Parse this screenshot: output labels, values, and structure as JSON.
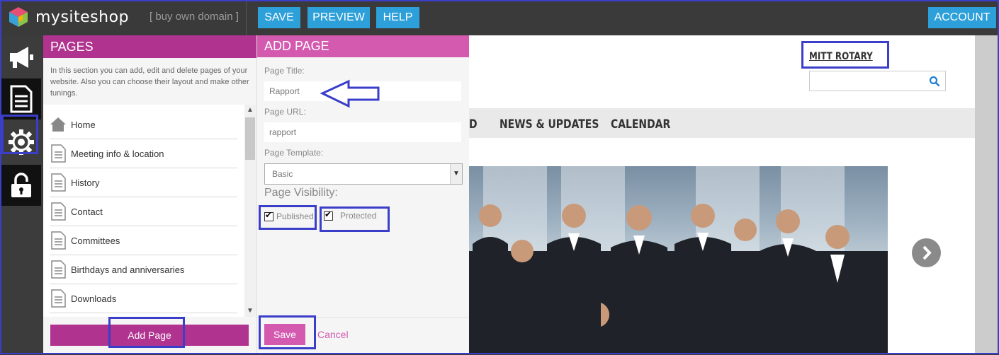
{
  "topbar": {
    "logo_text": "mysiteshop",
    "domain_link": "[ buy own domain ]",
    "buttons": {
      "save": "SAVE",
      "preview": "PREVIEW",
      "help": "HELP",
      "account": "ACCOUNT"
    },
    "accent_color": "#2d9fd9"
  },
  "rail": {
    "items": [
      {
        "icon": "megaphone-icon"
      },
      {
        "icon": "document-icon",
        "selected": true
      },
      {
        "icon": "gear-icon"
      },
      {
        "icon": "lock-icon"
      }
    ]
  },
  "pages_panel": {
    "title": "PAGES",
    "description": "In this section you can add, edit and delete pages of your website. Also you can choose their layout and make other tunings.",
    "items": [
      {
        "label": "Home",
        "icon": "home-icon"
      },
      {
        "label": "Meeting info & location",
        "icon": "page-icon"
      },
      {
        "label": "History",
        "icon": "page-icon"
      },
      {
        "label": "Contact",
        "icon": "page-icon"
      },
      {
        "label": "Committees",
        "icon": "page-icon"
      },
      {
        "label": "Birthdays and anniversaries",
        "icon": "page-icon"
      },
      {
        "label": "Downloads",
        "icon": "page-icon"
      }
    ],
    "add_button": "Add Page",
    "brand_color": "#b0338f"
  },
  "add_page": {
    "title": "ADD PAGE",
    "page_title_label": "Page Title:",
    "page_title_value": "Rapport",
    "page_url_label": "Page URL:",
    "page_url_value": "rapport",
    "template_label": "Page Template:",
    "template_value": "Basic",
    "visibility_label": "Page Visibility:",
    "published_label": "Published",
    "published_checked": true,
    "protected_label": "Protected",
    "protected_checked": true,
    "save_button": "Save",
    "cancel_link": "Cancel",
    "accent_color": "#d45ab0"
  },
  "site_preview": {
    "org_name": "MITT ROTARY",
    "search_placeholder": "",
    "nav_partial": "D",
    "nav_items": [
      "NEWS & UPDATES",
      "CALENDAR"
    ]
  },
  "annotation_color": "#3a3ec8"
}
